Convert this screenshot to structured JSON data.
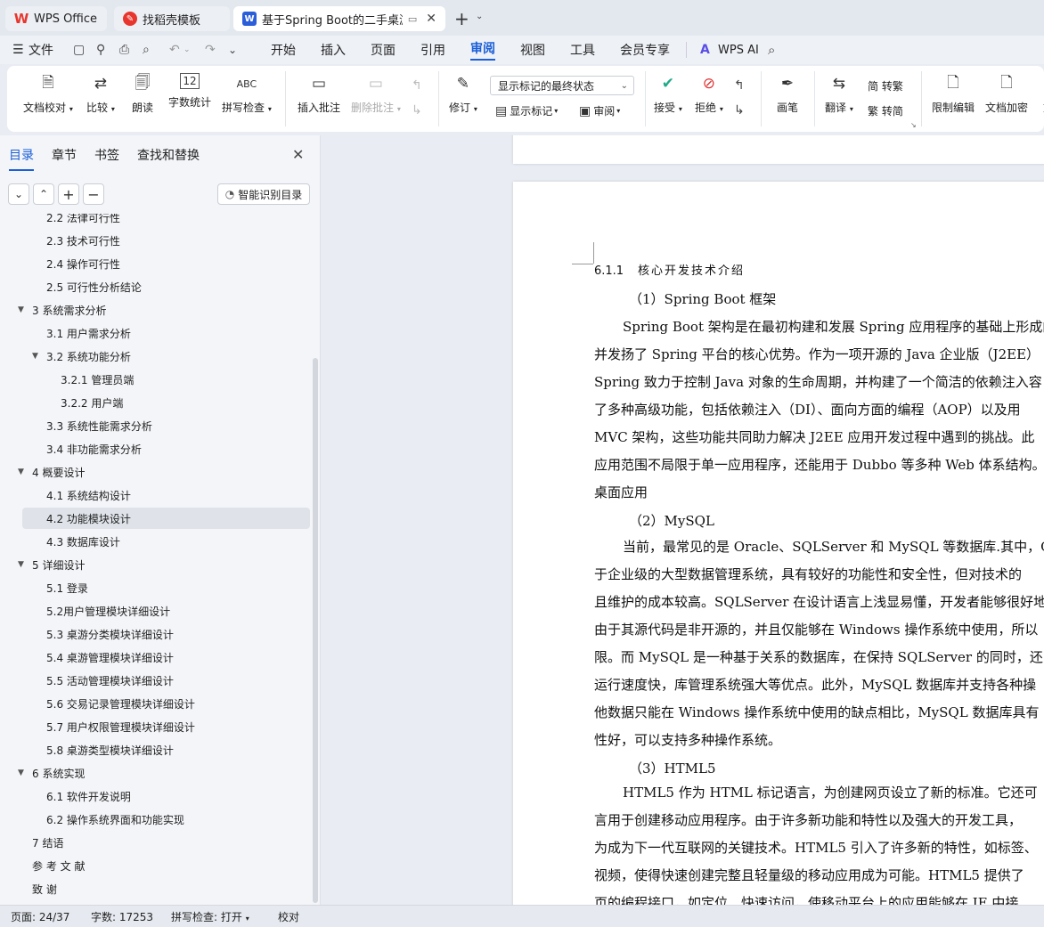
{
  "tabs": [
    {
      "label": "WPS Office",
      "icon": "wps-logo-icon"
    },
    {
      "label": "找稻壳模板",
      "icon": "docer-icon"
    },
    {
      "label": "基于Spring Boot的二手桌游交",
      "icon": "word-doc-icon"
    }
  ],
  "menu": {
    "file": "文件",
    "items": [
      "开始",
      "插入",
      "页面",
      "引用",
      "审阅",
      "视图",
      "工具",
      "会员专享"
    ],
    "active": "审阅",
    "wps_ai": "WPS AI"
  },
  "ribbon": {
    "doc_proof": "文档校对",
    "compare": "比较",
    "read_aloud": "朗读",
    "word_count": "字数统计",
    "spell_check": "拼写检查",
    "insert_comment": "插入批注",
    "delete_comment": "删除批注",
    "revise": "修订",
    "markup_select": "显示标记的最终状态",
    "show_markup": "显示标记",
    "review": "审阅",
    "accept": "接受",
    "reject": "拒绝",
    "pen": "画笔",
    "translate": "翻译",
    "to_trad": "简 转繁",
    "to_simp": "繁 转简",
    "restrict_edit": "限制编辑",
    "encrypt": "文档加密",
    "more": "文"
  },
  "sidebar": {
    "tabs": [
      "目录",
      "章节",
      "书签",
      "查找和替换"
    ],
    "smart_toc": "智能识别目录",
    "toc": [
      {
        "label": "2.2   法律可行性",
        "level": 1
      },
      {
        "label": "2.3   技术可行性",
        "level": 1
      },
      {
        "label": "2.4   操作可行性",
        "level": 1
      },
      {
        "label": "2.5   可行性分析结论",
        "level": 1
      },
      {
        "label": "3    系统需求分析",
        "level": 0,
        "expanded": true
      },
      {
        "label": "3.1   用户需求分析",
        "level": 1
      },
      {
        "label": "3.2   系统功能分析",
        "level": 1,
        "expanded": true
      },
      {
        "label": "3.2.1    管理员端",
        "level": 2
      },
      {
        "label": "3.2.2    用户端",
        "level": 2
      },
      {
        "label": "3.3   系统性能需求分析",
        "level": 1
      },
      {
        "label": "3.4   非功能需求分析",
        "level": 1
      },
      {
        "label": "4    概要设计",
        "level": 0,
        "expanded": true
      },
      {
        "label": "4.1   系统结构设计",
        "level": 1
      },
      {
        "label": "4.2   功能模块设计",
        "level": 1,
        "selected": true
      },
      {
        "label": "4.3   数据库设计",
        "level": 1
      },
      {
        "label": "5    详细设计",
        "level": 0,
        "expanded": true
      },
      {
        "label": "5.1  登录",
        "level": 1
      },
      {
        "label": "5.2用户管理模块详细设计",
        "level": 1
      },
      {
        "label": "5.3  桌游分类模块详细设计",
        "level": 1
      },
      {
        "label": "5.4  桌游管理模块详细设计",
        "level": 1
      },
      {
        "label": "5.5  活动管理模块详细设计",
        "level": 1
      },
      {
        "label": "5.6  交易记录管理模块详细设计",
        "level": 1
      },
      {
        "label": "5.7  用户权限管理模块详细设计",
        "level": 1
      },
      {
        "label": "5.8  桌游类型模块详细设计",
        "level": 1
      },
      {
        "label": "6    系统实现",
        "level": 0,
        "expanded": true
      },
      {
        "label": "6.1   软件开发说明",
        "level": 1
      },
      {
        "label": "6.2   操作系统界面和功能实现",
        "level": 1
      },
      {
        "label": "7   结语",
        "level": 0
      },
      {
        "label": "参   考   文   献",
        "level": 0
      },
      {
        "label": "致          谢",
        "level": 0
      }
    ]
  },
  "document": {
    "heading_num": "6.1.1",
    "heading_text": "核心开发技术介绍",
    "lines": [
      "（1）Spring Boot 框架",
      "Spring Boot 架构是在最初构建和发展 Spring 应用程序的基础上形成的",
      "并发扬了 Spring 平台的核心优势。作为一项开源的 Java 企业版（J2EE）",
      "Spring 致力于控制 Java 对象的生命周期，并构建了一个简洁的依赖注入容",
      "了多种高级功能，包括依赖注入（DI）、面向方面的编程（AOP）以及用",
      "MVC 架构，这些功能共同助力解决 J2EE 应用开发过程中遇到的挑战。此",
      "应用范围不局限于单一应用程序，还能用于 Dubbo 等多种 Web 体系结构。",
      "桌面应用",
      "（2）MySQL",
      "当前，最常见的是 Oracle、SQLServer 和 MySQL 等数据库.其中，Ora",
      "于企业级的大型数据管理系统，具有较好的功能性和安全性，但对技术的",
      "且维护的成本较高。SQLServer 在设计语言上浅显易懂，开发者能够很好地",
      "由于其源代码是非开源的，并且仅能够在 Windows 操作系统中使用，所以",
      "限。而 MySQL 是一种基于关系的数据库，在保持 SQLServer 的同时，还",
      "运行速度快，库管理系统强大等优点。此外，MySQL 数据库并支持各种操",
      "他数据只能在 Windows 操作系统中使用的缺点相比，MySQL 数据库具有",
      "性好，可以支持多种操作系统。",
      "（3）HTML5",
      "HTML5 作为 HTML 标记语言，为创建网页设立了新的标准。它还可",
      "言用于创建移动应用程序。由于许多新功能和特性以及强大的开发工具，",
      "为成为下一代互联网的关键技术。HTML5 引入了许多新的特性，如标签、",
      "视频，使得快速创建完整且轻量级的移动应用成为可能。HTML5 提供了",
      "页的编程接口，如定位、快速访问，使移动平台上的应用能够在 IE 中接"
    ]
  },
  "status": {
    "page": "页面: 24/37",
    "words": "字数: 17253",
    "spell": "拼写检查: 打开",
    "proof": "校对"
  },
  "colors": {
    "accent": "#1a5fd8",
    "wps_red": "#e8352d",
    "doc_blue": "#2b5fd9"
  }
}
